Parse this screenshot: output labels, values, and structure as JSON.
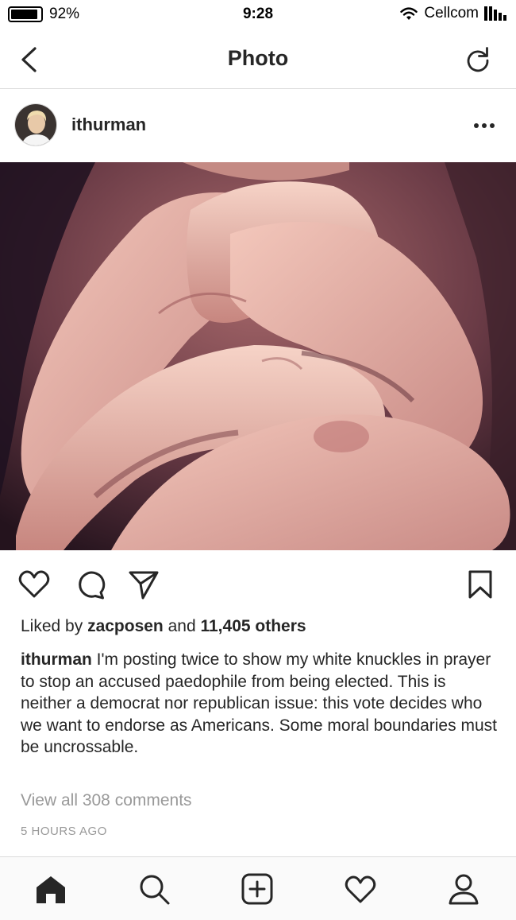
{
  "status_bar": {
    "battery": "92%",
    "battery_level": 0.92,
    "time": "9:28",
    "carrier": "Cellcom",
    "icons": [
      "battery-icon",
      "wifi-icon",
      "signal-icon"
    ]
  },
  "nav": {
    "title": "Photo",
    "icons": [
      "back-icon",
      "refresh-icon"
    ]
  },
  "post": {
    "username": "ithurman",
    "icons": [
      "avatar",
      "more-icon"
    ],
    "actions_icons": [
      "heart-icon",
      "comment-icon",
      "share-icon",
      "bookmark-icon"
    ],
    "likes_prefix": "Liked by ",
    "likes_user": "zacposen",
    "likes_middle": " and ",
    "likes_count": "11,405 others",
    "caption_user": "ithurman",
    "caption_text": " I'm posting twice to show my white knuckles in prayer to stop an accused paedophile from being elected.  This is neither a democrat nor republican issue: this vote decides who we want to endorse as Americans.  Some moral boundaries must be uncrossable.",
    "view_comments": "View all 308 comments",
    "time_ago": "5 HOURS AGO"
  },
  "tab_bar": {
    "icons": [
      "home-icon",
      "search-icon",
      "new-post-icon",
      "activity-icon",
      "profile-icon"
    ]
  },
  "colors": {
    "text": "#262626",
    "muted": "#999999",
    "divider": "#dbdbdb"
  }
}
